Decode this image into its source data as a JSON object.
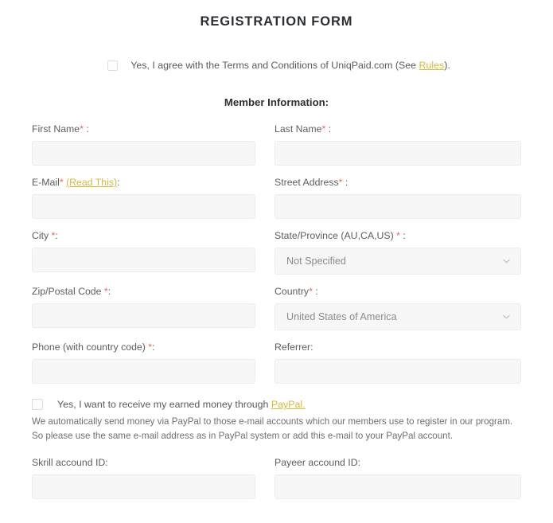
{
  "header": {
    "title": "REGISTRATION FORM"
  },
  "terms": {
    "checkbox_checked": false,
    "text_before": "Yes, I agree with the Terms and Conditions of UniqPaid.com (See ",
    "link_label": "Rules",
    "text_after": ").",
    "link_color": "#d8b83b"
  },
  "section": {
    "member_information": "Member Information:"
  },
  "required_marker": "*",
  "required_color": "#e8645a",
  "fields": {
    "first_name": {
      "label": "First Name",
      "required": true,
      "suffix": " :",
      "value": "",
      "placeholder": ""
    },
    "last_name": {
      "label": "Last Name",
      "required": true,
      "suffix": " :",
      "value": "",
      "placeholder": ""
    },
    "email": {
      "label": "E-Mail",
      "required": true,
      "link_label": "(Read This)",
      "suffix": ":",
      "value": "",
      "placeholder": ""
    },
    "street_address": {
      "label": "Street Address",
      "required": true,
      "suffix": " :",
      "value": "",
      "placeholder": ""
    },
    "city": {
      "label": "City",
      "required": true,
      "suffix": ":",
      "value": "",
      "placeholder": ""
    },
    "state_province": {
      "label": "State/Province (AU,CA,US)",
      "required": true,
      "suffix": " :",
      "selected": "Not Specified"
    },
    "zip_postal_code": {
      "label": "Zip/Postal Code",
      "required": true,
      "suffix": ":",
      "value": "",
      "placeholder": ""
    },
    "country": {
      "label": "Country",
      "required": true,
      "suffix": " :",
      "selected": "United States of America"
    },
    "phone": {
      "label": "Phone (with country code)",
      "required": true,
      "suffix": ":",
      "value": "",
      "placeholder": ""
    },
    "referrer": {
      "label": "Referrer:",
      "required": false,
      "value": "",
      "placeholder": ""
    },
    "skrill": {
      "label": "Skrill accound ID:",
      "required": false,
      "value": "",
      "placeholder": ""
    },
    "payeer": {
      "label": "Payeer accound ID:",
      "required": false,
      "value": "",
      "placeholder": ""
    }
  },
  "paypal": {
    "checkbox_checked": false,
    "text_before": "Yes, I want to receive my earned money through ",
    "link_label": "PayPal.",
    "note_line_1": "We automatically send money via PayPal to those e-mail accounts which our members use to register in our program.",
    "note_line_2": "So please use the same e-mail address as in PayPal system or add this e-mail to your PayPal account."
  },
  "icons": {
    "chevron_down": "chevron-down-icon"
  }
}
